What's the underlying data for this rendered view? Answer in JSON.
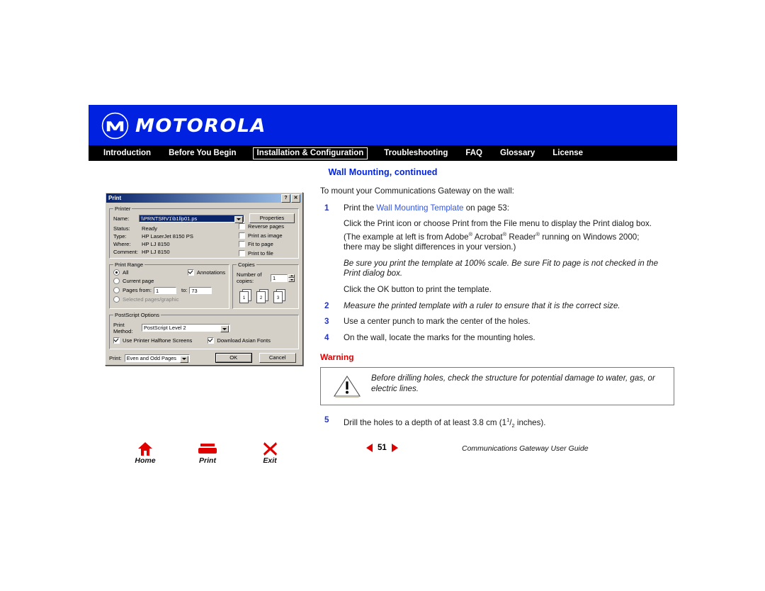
{
  "header": {
    "brand": "MOTOROLA",
    "logo_icon": "motorola-m-logo",
    "nav": [
      {
        "label": "Introduction",
        "selected": false
      },
      {
        "label": "Before You Begin",
        "selected": false
      },
      {
        "label": "Installation & Configuration",
        "selected": true
      },
      {
        "label": "Troubleshooting",
        "selected": false
      },
      {
        "label": "FAQ",
        "selected": false
      },
      {
        "label": "Glossary",
        "selected": false
      },
      {
        "label": "License",
        "selected": false
      }
    ],
    "subtitle": "Wall Mounting, continued",
    "brand_color": "#0022e0",
    "nav_bg": "#000000"
  },
  "body": {
    "intro": "To mount your Communications Gateway on the wall:",
    "step1_num": "1",
    "step1_pre": "Print the ",
    "step1_link": "Wall Mounting Template",
    "step1_post": " on page 53:",
    "para1a": "Click the Print icon or choose Print from the File menu to display the Print dialog box.",
    "para1b_pre": "(The example at left is from Adobe",
    "para1b_mid1": " Acrobat",
    "para1b_mid2": " Reader",
    "para1b_post": " running on Windows 2000;",
    "para1c": "there may be slight differences in your version.)",
    "reg_mark": "®",
    "para2_ital": "Be sure you print the template at 100% scale. Be sure Fit to page is not checked in the Print dialog box.",
    "para3": "Click the OK button to print the template.",
    "step2_num": "2",
    "step2_text": "Measure the printed template with a ruler to ensure that it is the correct size.",
    "step3_num": "3",
    "step3_text": "Use a center punch to mark the center of the holes.",
    "step4_num": "4",
    "step4_text": "On the wall, locate the marks for the mounting holes.",
    "warning_title": "Warning",
    "warning_icon": "warning-triangle-icon",
    "warning_text": "Before drilling holes, check the structure for potential damage to water, gas, or electric lines.",
    "warning_color": "#e00000",
    "step5_num": "5",
    "step5_pre": "Drill the holes to a depth of at least 3.8 cm (1",
    "step5_sup": "1",
    "step5_frac": "/",
    "step5_sub": "2",
    "step5_post": " inches)."
  },
  "print_dialog": {
    "title": "Print",
    "help_button": "?",
    "close_button": "✕",
    "printer_group": "Printer",
    "name_label": "Name:",
    "name_value": "\\\\PRNTSRV1\\b1llp01.ps",
    "properties_button": "Properties",
    "status_label": "Status:",
    "status_value": "Ready",
    "type_label": "Type:",
    "type_value": "HP LaserJet 8150 PS",
    "where_label": "Where:",
    "where_value": "HP LJ 8150",
    "comment_label": "Comment:",
    "comment_value": "HP LJ 8150",
    "printer_checks": [
      {
        "label": "Reverse pages",
        "checked": false
      },
      {
        "label": "Print as image",
        "checked": false
      },
      {
        "label": "Fit to page",
        "checked": false
      },
      {
        "label": "Print to file",
        "checked": false
      }
    ],
    "range_group": "Print Range",
    "range_options": [
      {
        "label": "All",
        "selected": true,
        "disabled": false
      },
      {
        "label": "Current page",
        "selected": false,
        "disabled": false
      },
      {
        "label": "Pages from:",
        "selected": false,
        "disabled": false
      },
      {
        "label": "Selected pages/graphic",
        "selected": false,
        "disabled": true
      }
    ],
    "annotations_label": "Annotations",
    "annotations_checked": true,
    "pages_from_value": "1",
    "pages_to_label": "to:",
    "pages_to_value": "73",
    "copies_group": "Copies",
    "copies_label": "Number of copies:",
    "copies_value": "1",
    "collate_icons": [
      "1",
      "2",
      "3"
    ],
    "ps_group": "PostScript Options",
    "print_method_label": "Print Method:",
    "print_method_value": "PostScript Level 2",
    "halftone_label": "Use Printer Halftone Screens",
    "halftone_checked": true,
    "asian_fonts_label": "Download Asian Fonts",
    "asian_fonts_checked": true,
    "print_label": "Print:",
    "print_value": "Even and Odd Pages",
    "ok_button": "OK",
    "cancel_button": "Cancel"
  },
  "footer": {
    "nav_icons": [
      {
        "label": "Home",
        "icon": "home-icon"
      },
      {
        "label": "Print",
        "icon": "printer-icon"
      },
      {
        "label": "Exit",
        "icon": "exit-x-icon"
      }
    ],
    "prev_icon": "prev-arrow-icon",
    "next_icon": "next-arrow-icon",
    "page_number": "51",
    "guide_title": "Communications Gateway User Guide",
    "accent_color": "#e00000"
  }
}
